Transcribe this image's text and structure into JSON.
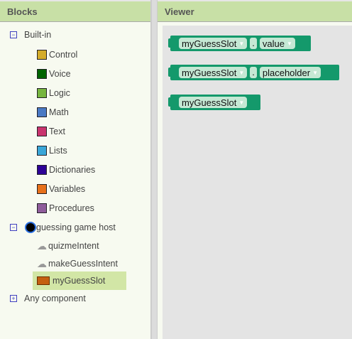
{
  "blocks_panel": {
    "title": "Blocks",
    "builtin": {
      "label": "Built-in",
      "toggle": "−",
      "items": [
        {
          "label": "Control",
          "color": "#d4ac2a"
        },
        {
          "label": "Voice",
          "color": "#006400"
        },
        {
          "label": "Logic",
          "color": "#77b540"
        },
        {
          "label": "Math",
          "color": "#4a79c4"
        },
        {
          "label": "Text",
          "color": "#c9336e"
        },
        {
          "label": "Lists",
          "color": "#3aa6d8"
        },
        {
          "label": "Dictionaries",
          "color": "#2d0296"
        },
        {
          "label": "Variables",
          "color": "#e7701b"
        },
        {
          "label": "Procedures",
          "color": "#8f5c9b"
        }
      ]
    },
    "component": {
      "label": "guessing game host",
      "toggle": "−",
      "items": [
        {
          "label": "quizmeIntent",
          "icon": "cloud-icon"
        },
        {
          "label": "makeGuessIntent",
          "icon": "cloud-icon"
        },
        {
          "label": "myGuessSlot",
          "icon": "box-icon",
          "selected": true
        }
      ]
    },
    "any": {
      "label": "Any component",
      "toggle": "+"
    }
  },
  "viewer": {
    "title": "Viewer",
    "blocks": [
      {
        "component": "myGuessSlot",
        "dot": ".",
        "property": "value"
      },
      {
        "component": "myGuessSlot",
        "dot": ".",
        "property": "placeholder"
      },
      {
        "component": "myGuessSlot"
      }
    ]
  },
  "accent": "#14996b"
}
